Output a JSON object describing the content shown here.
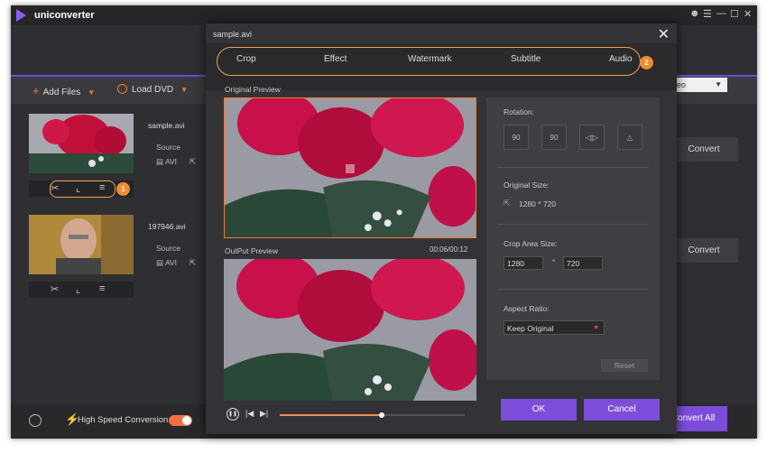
{
  "app": {
    "name": "uniconverter"
  },
  "toolbar": {
    "add_files": "Add Files",
    "load_dvd": "Load DVD",
    "target": "Video"
  },
  "files": [
    {
      "name": "sample.avi",
      "source": "Source",
      "format": "AVI",
      "convert": "Convert"
    },
    {
      "name": "197946.avi",
      "source": "Source",
      "format": "AVI",
      "convert": "Convert"
    }
  ],
  "badges": {
    "one": "1",
    "two": "2"
  },
  "bottom": {
    "high_speed": "High Speed Conversion",
    "convert_all": "Convert All"
  },
  "dialog": {
    "title": "sample.avi",
    "tabs": [
      "Crop",
      "Effect",
      "Watermark",
      "Subtitle",
      "Audio"
    ],
    "original_preview": "Original Preview",
    "output_preview": "OutPut Preview",
    "timecode": "00:06/00:12",
    "rotation_label": "Rotation:",
    "rotate_left": "90",
    "rotate_right": "90",
    "original_size_label": "Original Size:",
    "original_size": "1280 * 720",
    "crop_area_label": "Crop Area Size:",
    "crop_w": "1280",
    "crop_x": "*",
    "crop_h": "720",
    "aspect_label": "Aspect Ratio:",
    "aspect_value": "Keep Original",
    "reset": "Reset",
    "ok": "OK",
    "cancel": "Cancel",
    "seek_progress": 0.55
  },
  "colors": {
    "accent": "#7c4ddb",
    "highlight": "#f0a050",
    "bg": "#2f2f33"
  },
  "icons": [
    "logo-icon",
    "user-icon",
    "menu-icon",
    "minimize-icon",
    "maximize-icon",
    "close-icon",
    "plus-icon",
    "disc-icon",
    "cut-icon",
    "crop-icon",
    "adjust-icon",
    "film-icon",
    "expand-icon",
    "alarm-icon",
    "bolt-icon",
    "play-pause-icon",
    "prev-icon",
    "next-icon",
    "rotate-left-icon",
    "rotate-right-icon",
    "flip-horizontal-icon",
    "flip-vertical-icon",
    "size-icon"
  ]
}
